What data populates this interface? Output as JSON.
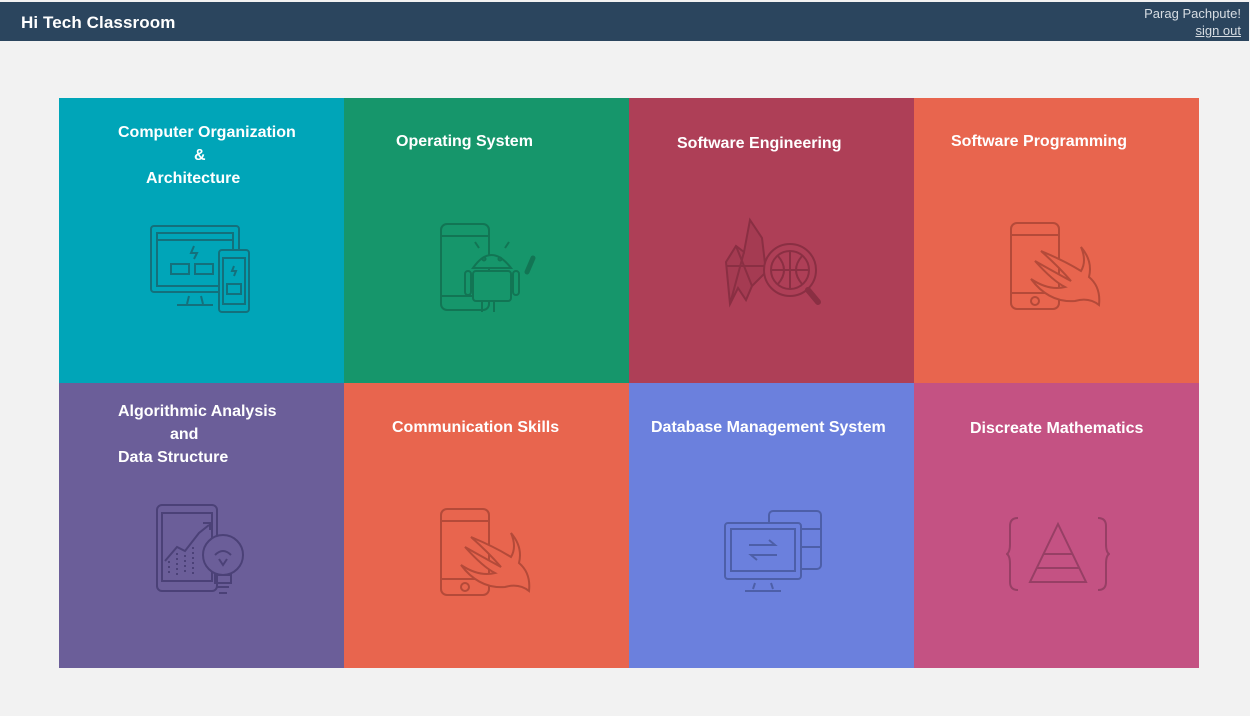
{
  "header": {
    "brand": "Hi Tech Classroom",
    "user_name": "Parag Pachpute!",
    "signout_label": "sign out",
    "background": "#2b455e"
  },
  "courses": [
    {
      "id": "coa",
      "title_lines": [
        "Computer Organization",
        "&",
        "Architecture"
      ],
      "color": "#00a5b8",
      "icon": "responsive-devices-icon"
    },
    {
      "id": "os",
      "title_lines": [
        "Operating System"
      ],
      "color": "#16966b",
      "icon": "android-phone-icon"
    },
    {
      "id": "se",
      "title_lines": [
        "Software Engineering"
      ],
      "color": "#ae3f57",
      "icon": "map-search-icon"
    },
    {
      "id": "sp",
      "title_lines": [
        "Software Programming"
      ],
      "color": "#e8654e",
      "icon": "swift-phone-icon"
    },
    {
      "id": "aads",
      "title_lines": [
        "Algorithmic Analysis",
        "and",
        "Data Structure"
      ],
      "color": "#6b5e99",
      "icon": "tablet-idea-icon"
    },
    {
      "id": "cs",
      "title_lines": [
        "Communication Skills"
      ],
      "color": "#e8654e",
      "icon": "swift-phone-icon"
    },
    {
      "id": "dbms",
      "title_lines": [
        "Database Management System"
      ],
      "color": "#6b80dd",
      "icon": "database-monitor-icon"
    },
    {
      "id": "dm",
      "title_lines": [
        "Discreate Mathematics"
      ],
      "color": "#c45283",
      "icon": "pyramid-braces-icon"
    }
  ]
}
